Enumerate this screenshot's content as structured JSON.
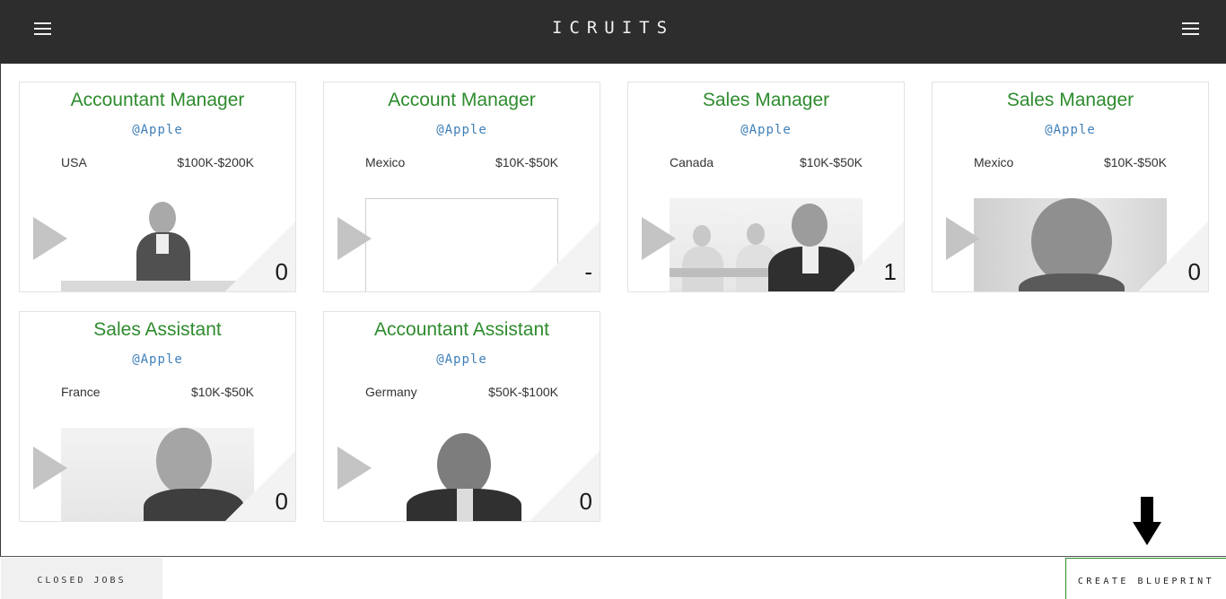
{
  "header": {
    "brand": "ICRUITS",
    "left_menu_icon": "hamburger-menu-icon",
    "right_menu_icon": "hamburger-menu-icon"
  },
  "jobs": [
    {
      "title": "Accountant Manager",
      "company": "@Apple",
      "location": "USA",
      "salary": "$100K-$200K",
      "count": "0",
      "photo": "woman-at-desk"
    },
    {
      "title": "Account Manager",
      "company": "@Apple",
      "location": "Mexico",
      "salary": "$10K-$50K",
      "count": "-",
      "photo": "empty"
    },
    {
      "title": "Sales Manager",
      "company": "@Apple",
      "location": "Canada",
      "salary": "$10K-$50K",
      "count": "1",
      "photo": "man-in-office"
    },
    {
      "title": "Sales Manager",
      "company": "@Apple",
      "location": "Mexico",
      "salary": "$10K-$50K",
      "count": "0",
      "photo": "smiling-man-portrait"
    },
    {
      "title": "Sales Assistant",
      "company": "@Apple",
      "location": "France",
      "salary": "$10K-$50K",
      "count": "0",
      "photo": "man-with-glasses"
    },
    {
      "title": "Accountant Assistant",
      "company": "@Apple",
      "location": "Germany",
      "salary": "$50K-$100K",
      "count": "0",
      "photo": "man-in-suit"
    }
  ],
  "footer": {
    "closed_jobs_label": "CLOSED JOBS",
    "create_blueprint_label": "CREATE BLUEPRINT",
    "arrow_icon": "arrow-down-icon"
  },
  "colors": {
    "topbar": "#2d2d2d",
    "title_green": "#2e8b2e",
    "company_blue": "#3f7fb8"
  }
}
